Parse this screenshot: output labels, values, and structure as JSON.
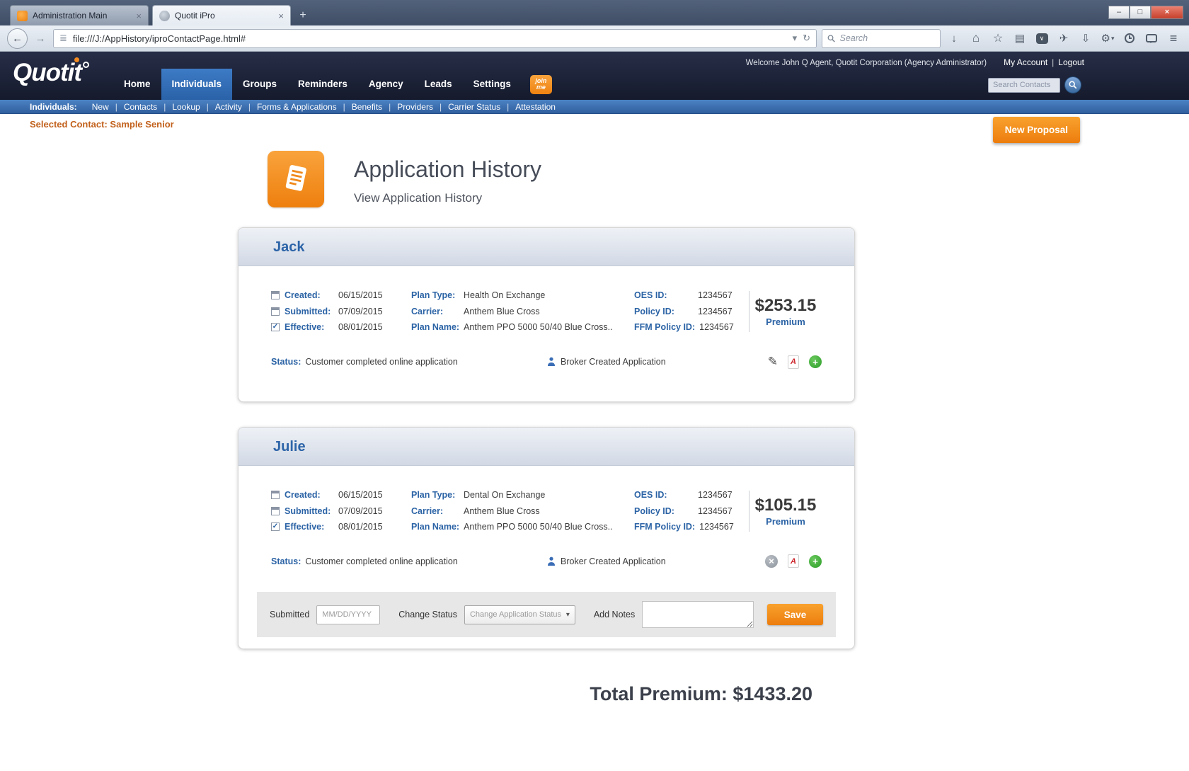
{
  "colors": {
    "accent_orange": "#f68b1f",
    "link_blue": "#2b63a5",
    "header_navy": "#1b2134",
    "subnav_blue": "#3a70b8",
    "pdf_red": "#cc2229",
    "add_green": "#2f9e2b"
  },
  "ui": {
    "pipe": "|"
  },
  "icons": {
    "close": "×",
    "plus": "+",
    "win_min": "–",
    "win_max": "□",
    "back": "←",
    "forward": "→",
    "caret": "▾",
    "reload": "↻",
    "page": "≣",
    "download": "↓",
    "home": "⌂",
    "star": "☆",
    "clipboard": "▤",
    "pocket_chevron": "∨",
    "share": "✈",
    "inbox": "⇩",
    "gear": "⚙",
    "menu": "≡",
    "pencil": "✎",
    "check": "✓",
    "pdf_letter": "A"
  },
  "browser": {
    "tabs": [
      {
        "label": "Administration Main"
      },
      {
        "label": "Quotit iPro"
      }
    ],
    "url": "file:///J:/AppHistory/iproContactPage.html#",
    "search_placeholder": "Search"
  },
  "header": {
    "logo": "Quotit",
    "welcome": "Welcome John Q Agent, Quotit Corporation (Agency Administrator)",
    "my_account": "My Account",
    "logout": "Logout",
    "nav": [
      "Home",
      "Individuals",
      "Groups",
      "Reminders",
      "Agency",
      "Leads",
      "Settings"
    ],
    "joinme_top": "join",
    "joinme_bottom": "me",
    "search_contacts_placeholder": "Search Contacts"
  },
  "subnav": {
    "label": "Individuals:",
    "items": [
      "New",
      "Contacts",
      "Lookup",
      "Activity",
      "Forms & Applications",
      "Benefits",
      "Providers",
      "Carrier Status",
      "Attestation"
    ]
  },
  "context": {
    "selected_contact": "Selected Contact: Sample Senior",
    "new_proposal": "New Proposal"
  },
  "page": {
    "title": "Application History",
    "subtitle": "View Application History",
    "total_premium": "Total Premium: $1433.20"
  },
  "labels": {
    "created": "Created:",
    "submitted": "Submitted:",
    "effective": "Effective:",
    "plan_type": "Plan Type:",
    "carrier": "Carrier:",
    "plan_name": "Plan Name:",
    "oes_id": "OES ID:",
    "policy_id": "Policy ID:",
    "ffm_policy_id": "FFM Policy ID:",
    "status": "Status:",
    "premium": "Premium"
  },
  "applications": [
    {
      "name": "Jack",
      "created": "06/15/2015",
      "submitted": "07/09/2015",
      "effective": "08/01/2015",
      "plan_type": "Health On Exchange",
      "carrier": "Anthem Blue Cross",
      "plan_name": "Anthem PPO 5000 50/40 Blue Cross..",
      "oes_id": "1234567",
      "policy_id": "1234567",
      "ffm_policy_id": "1234567",
      "premium": "$253.15",
      "status": "Customer completed online application",
      "origin": "Broker Created Application"
    },
    {
      "name": "Julie",
      "created": "06/15/2015",
      "submitted": "07/09/2015",
      "effective": "08/01/2015",
      "plan_type": "Dental On Exchange",
      "carrier": "Anthem Blue Cross",
      "plan_name": "Anthem PPO 5000 50/40 Blue Cross..",
      "oes_id": "1234567",
      "policy_id": "1234567",
      "ffm_policy_id": "1234567",
      "premium": "$105.15",
      "status": "Customer completed online application",
      "origin": "Broker Created Application"
    }
  ],
  "form": {
    "submitted_label": "Submitted",
    "date_placeholder": "MM/DD/YYYY",
    "change_status_label": "Change Status",
    "change_status_placeholder": "Change Application Status",
    "add_notes_label": "Add Notes",
    "save_label": "Save"
  }
}
